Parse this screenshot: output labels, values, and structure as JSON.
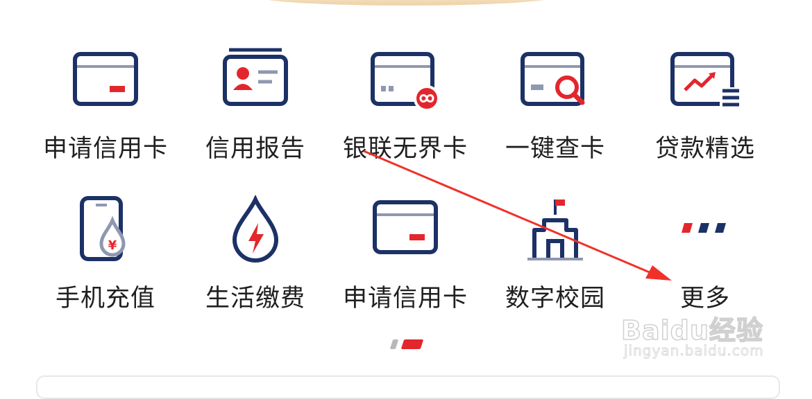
{
  "menu": {
    "row1": [
      {
        "label": "申请信用卡",
        "icon": "credit-card-icon"
      },
      {
        "label": "信用报告",
        "icon": "id-card-icon"
      },
      {
        "label": "银联无界卡",
        "icon": "unionpay-card-infinity-icon"
      },
      {
        "label": "一键查卡",
        "icon": "card-search-icon"
      },
      {
        "label": "贷款精选",
        "icon": "loan-chart-icon"
      }
    ],
    "row2": [
      {
        "label": "手机充值",
        "icon": "phone-yuan-icon"
      },
      {
        "label": "生活缴费",
        "icon": "utility-bolt-drop-icon"
      },
      {
        "label": "申请信用卡",
        "icon": "credit-card-icon"
      },
      {
        "label": "数字校园",
        "icon": "school-flag-icon"
      },
      {
        "label": "更多",
        "icon": "more-dots-icon"
      }
    ]
  },
  "pager": {
    "total_pages": 2,
    "active_page": 2
  },
  "watermark": {
    "logo": "Baidu经验",
    "url": "jingyan.baidu.com"
  },
  "colors": {
    "navy": "#1c3166",
    "red": "#e3262d",
    "gray": "#8e98b0",
    "text": "#1f1f1f"
  }
}
